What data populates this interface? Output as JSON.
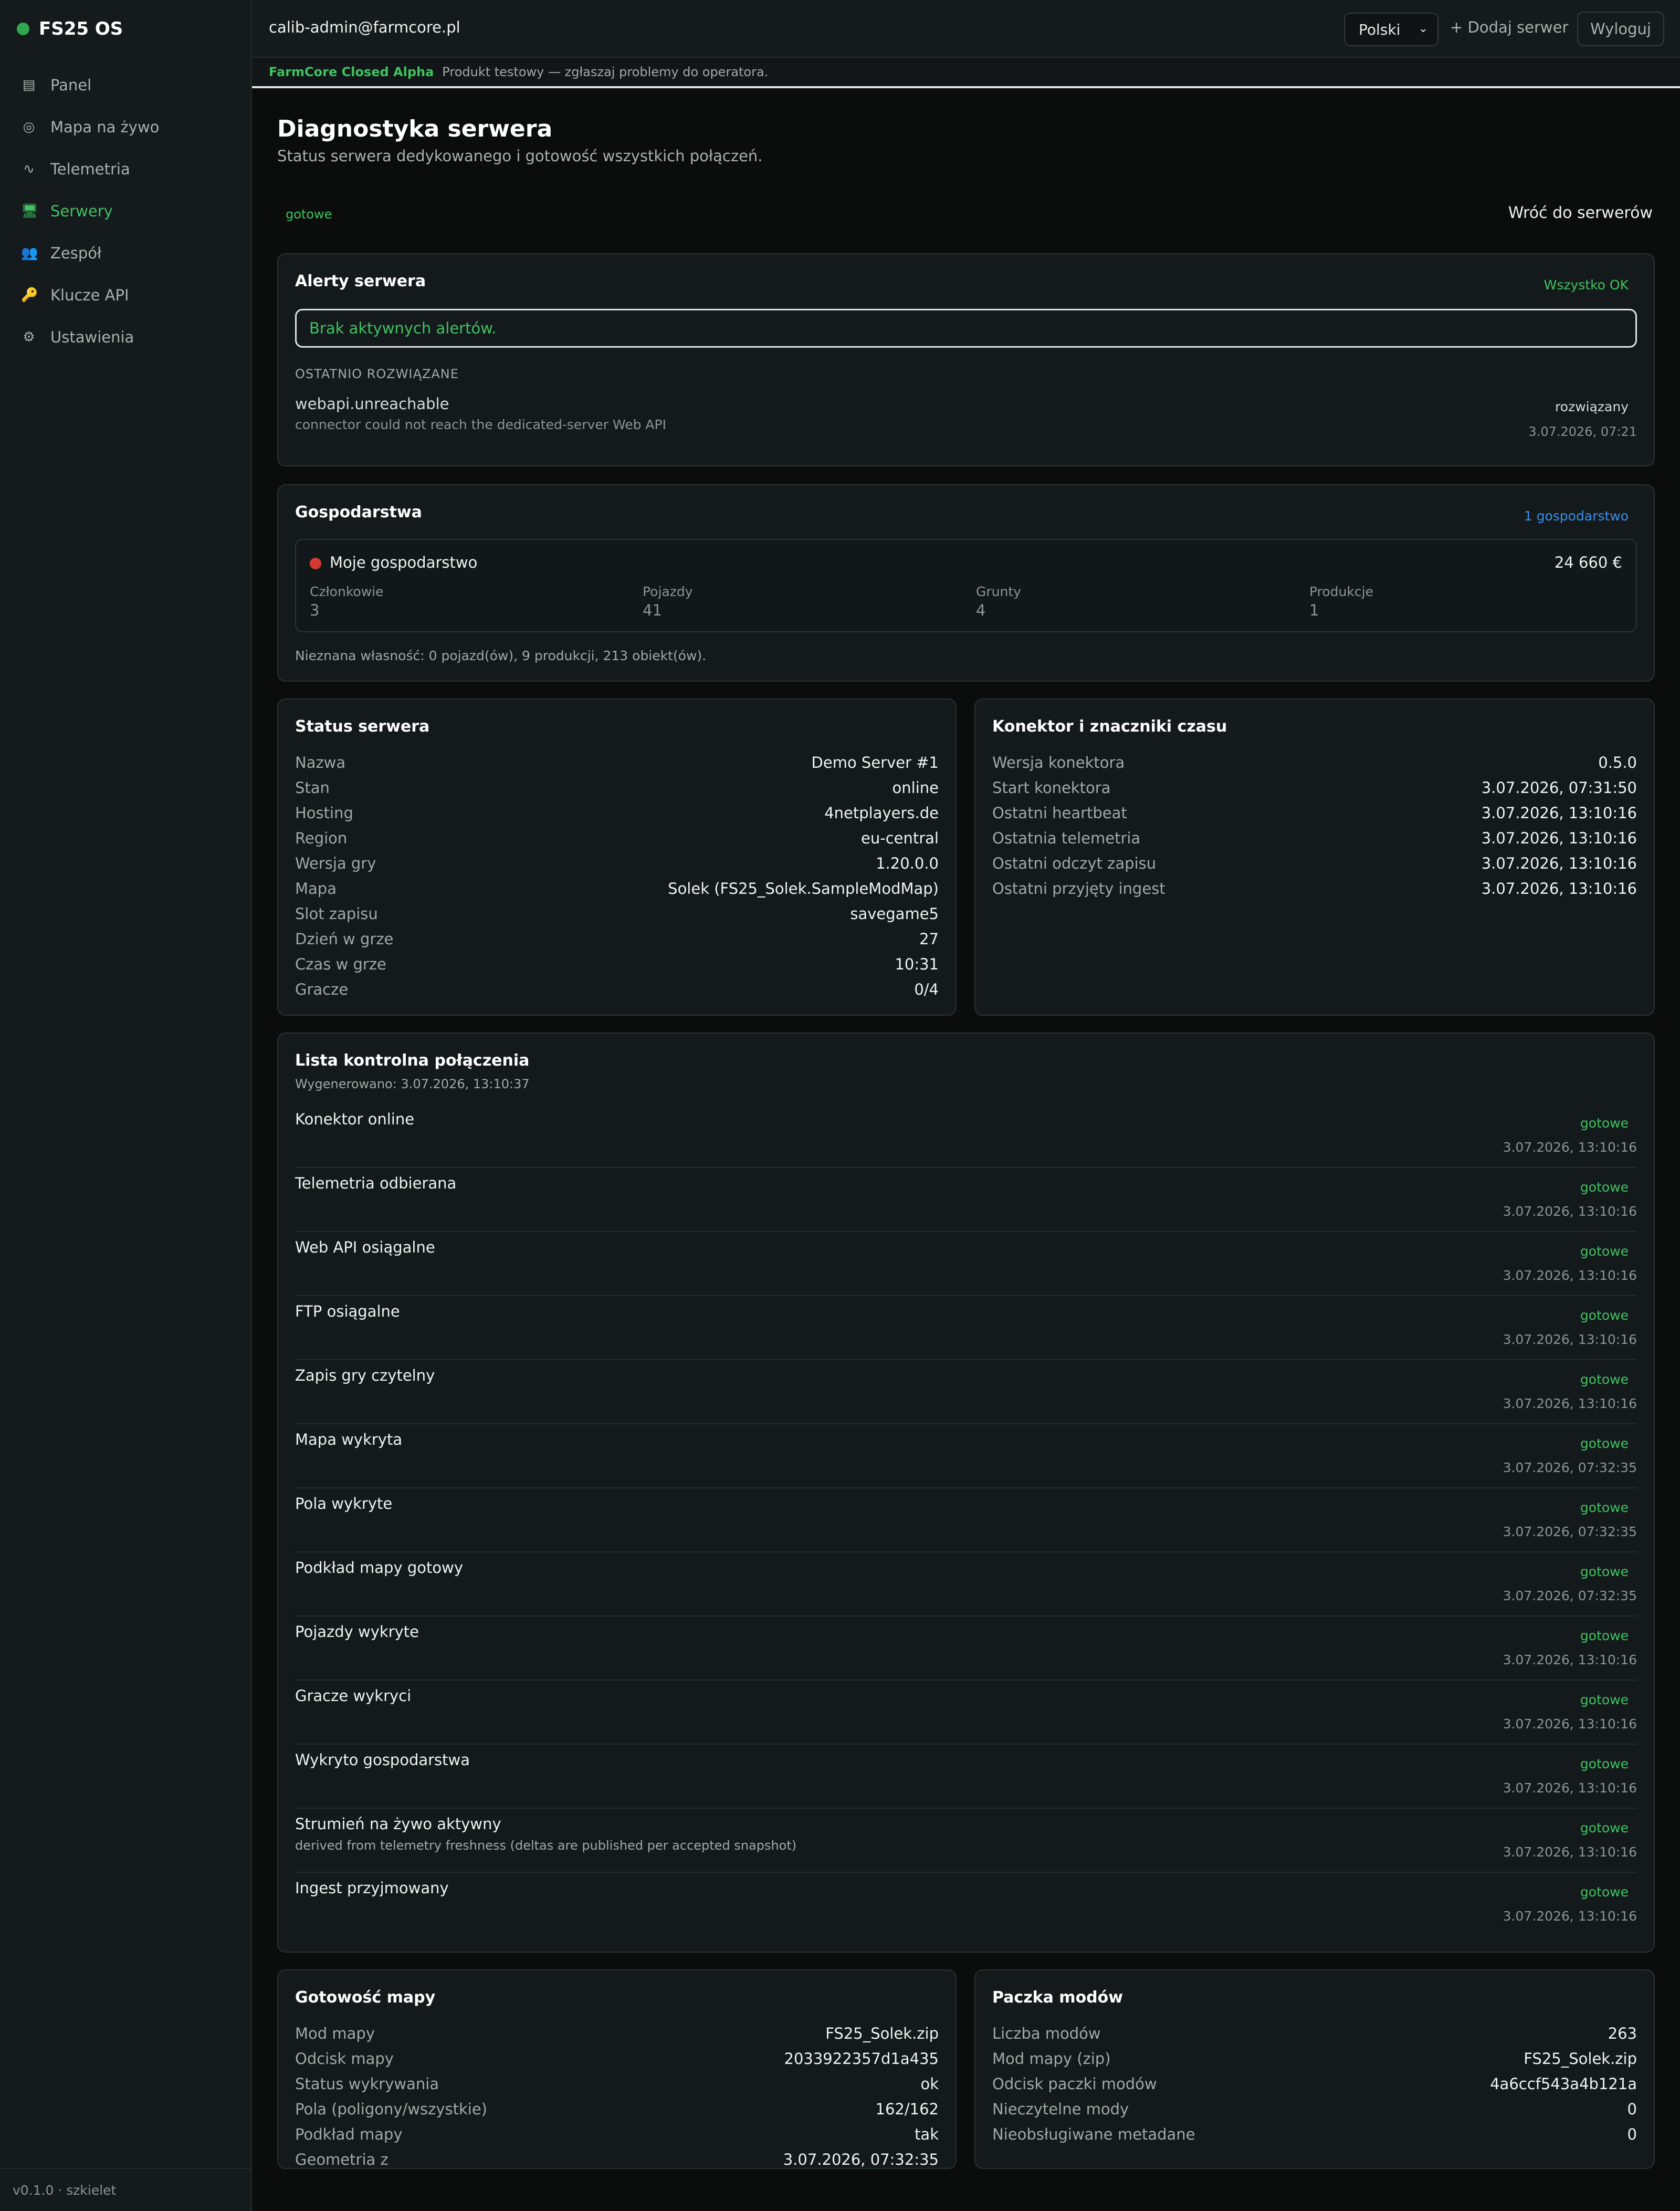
{
  "app": {
    "brand": "FS25 OS",
    "version": "v0.1.0 · szkielet"
  },
  "colors": {
    "accent": "#3fc25f",
    "link": "#3b8fe8",
    "danger": "#d33a32",
    "background": "#0a0d0b"
  },
  "sidebar": {
    "items": [
      {
        "label": "Panel",
        "icon": "dashboard-icon",
        "glyph": "▤"
      },
      {
        "label": "Mapa na żywo",
        "icon": "target-icon",
        "glyph": "◎"
      },
      {
        "label": "Telemetria",
        "icon": "wave-icon",
        "glyph": "∿"
      },
      {
        "label": "Serwery",
        "icon": "monitor-icon",
        "glyph": "🖥"
      },
      {
        "label": "Zespół",
        "icon": "people-icon",
        "glyph": "👥"
      },
      {
        "label": "Klucze API",
        "icon": "key-icon",
        "glyph": "🔑"
      },
      {
        "label": "Ustawienia",
        "icon": "gear-icon",
        "glyph": "⚙"
      }
    ],
    "active": "Serwery"
  },
  "topbar": {
    "user_email": "calib-admin@farmcore.pl",
    "language": "Polski",
    "add_server": "+ Dodaj serwer",
    "logout": "Wyloguj"
  },
  "alpha_banner": {
    "tag": "FarmCore Closed Alpha",
    "text": "Produkt testowy — zgłaszaj problemy do operatora."
  },
  "page": {
    "title": "Diagnostyka serwera",
    "subtitle": "Status serwera dedykowanego i gotowość wszystkich połączeń.",
    "status": "gotowe",
    "back": "Wróć do serwerów"
  },
  "alerts": {
    "title": "Alerty serwera",
    "badge": "Wszystko OK",
    "empty": "Brak aktywnych alertów.",
    "resolved_label": "OSTATNIO ROZWIĄZANE",
    "resolved": {
      "name": "webapi.unreachable",
      "description": "connector could not reach the dedicated-server Web API",
      "status": "rozwiązany",
      "time": "3.07.2026, 07:21"
    }
  },
  "farms": {
    "title": "Gospodarstwa",
    "badge": "1 gospodarstwo",
    "farm": {
      "name": "Moje gospodarstwo",
      "money": "24 660 €",
      "stats": [
        {
          "label": "Członkowie",
          "value": "3"
        },
        {
          "label": "Pojazdy",
          "value": "41"
        },
        {
          "label": "Grunty",
          "value": "4"
        },
        {
          "label": "Produkcje",
          "value": "1"
        }
      ]
    },
    "note": "Nieznana własność: 0 pojazd(ów), 9 produkcji, 213 obiekt(ów)."
  },
  "server_status": {
    "title": "Status serwera",
    "rows": [
      {
        "key": "Nazwa",
        "value": "Demo Server #1"
      },
      {
        "key": "Stan",
        "value": "online"
      },
      {
        "key": "Hosting",
        "value": "4netplayers.de"
      },
      {
        "key": "Region",
        "value": "eu-central"
      },
      {
        "key": "Wersja gry",
        "value": "1.20.0.0"
      },
      {
        "key": "Mapa",
        "value": "Solek (FS25_Solek.SampleModMap)"
      },
      {
        "key": "Slot zapisu",
        "value": "savegame5"
      },
      {
        "key": "Dzień w grze",
        "value": "27"
      },
      {
        "key": "Czas w grze",
        "value": "10:31"
      },
      {
        "key": "Gracze",
        "value": "0/4"
      }
    ]
  },
  "connector": {
    "title": "Konektor i znaczniki czasu",
    "rows": [
      {
        "key": "Wersja konektora",
        "value": "0.5.0"
      },
      {
        "key": "Start konektora",
        "value": "3.07.2026, 07:31:50"
      },
      {
        "key": "Ostatni heartbeat",
        "value": "3.07.2026, 13:10:16"
      },
      {
        "key": "Ostatnia telemetria",
        "value": "3.07.2026, 13:10:16"
      },
      {
        "key": "Ostatni odczyt zapisu",
        "value": "3.07.2026, 13:10:16"
      },
      {
        "key": "Ostatni przyjęty ingest",
        "value": "3.07.2026, 13:10:16"
      }
    ]
  },
  "checklist": {
    "title": "Lista kontrolna połączenia",
    "generated": "Wygenerowano: 3.07.2026, 13:10:37",
    "items": [
      {
        "name": "Konektor online",
        "note": "",
        "status": "gotowe",
        "time": "3.07.2026, 13:10:16"
      },
      {
        "name": "Telemetria odbierana",
        "note": "",
        "status": "gotowe",
        "time": "3.07.2026, 13:10:16"
      },
      {
        "name": "Web API osiągalne",
        "note": "",
        "status": "gotowe",
        "time": "3.07.2026, 13:10:16"
      },
      {
        "name": "FTP osiągalne",
        "note": "",
        "status": "gotowe",
        "time": "3.07.2026, 13:10:16"
      },
      {
        "name": "Zapis gry czytelny",
        "note": "",
        "status": "gotowe",
        "time": "3.07.2026, 13:10:16"
      },
      {
        "name": "Mapa wykryta",
        "note": "",
        "status": "gotowe",
        "time": "3.07.2026, 07:32:35"
      },
      {
        "name": "Pola wykryte",
        "note": "",
        "status": "gotowe",
        "time": "3.07.2026, 07:32:35"
      },
      {
        "name": "Podkład mapy gotowy",
        "note": "",
        "status": "gotowe",
        "time": "3.07.2026, 07:32:35"
      },
      {
        "name": "Pojazdy wykryte",
        "note": "",
        "status": "gotowe",
        "time": "3.07.2026, 13:10:16"
      },
      {
        "name": "Gracze wykryci",
        "note": "",
        "status": "gotowe",
        "time": "3.07.2026, 13:10:16"
      },
      {
        "name": "Wykryto gospodarstwa",
        "note": "",
        "status": "gotowe",
        "time": "3.07.2026, 13:10:16"
      },
      {
        "name": "Strumień na żywo aktywny",
        "note": "derived from telemetry freshness (deltas are published per accepted snapshot)",
        "status": "gotowe",
        "time": "3.07.2026, 13:10:16"
      },
      {
        "name": "Ingest przyjmowany",
        "note": "",
        "status": "gotowe",
        "time": "3.07.2026, 13:10:16"
      }
    ]
  },
  "map_readiness": {
    "title": "Gotowość mapy",
    "rows": [
      {
        "key": "Mod mapy",
        "value": "FS25_Solek.zip"
      },
      {
        "key": "Odcisk mapy",
        "value": "2033922357d1a435"
      },
      {
        "key": "Status wykrywania",
        "value": "ok"
      },
      {
        "key": "Pola (poligony/wszystkie)",
        "value": "162/162"
      },
      {
        "key": "Podkład mapy",
        "value": "tak"
      },
      {
        "key": "Geometria z",
        "value": "3.07.2026, 07:32:35"
      }
    ]
  },
  "mod_pack": {
    "title": "Paczka modów",
    "rows": [
      {
        "key": "Liczba modów",
        "value": "263"
      },
      {
        "key": "Mod mapy (zip)",
        "value": "FS25_Solek.zip"
      },
      {
        "key": "Odcisk paczki modów",
        "value": "4a6ccf543a4b121a"
      },
      {
        "key": "Nieczytelne mody",
        "value": "0"
      },
      {
        "key": "Nieobsługiwane metadane",
        "value": "0"
      }
    ]
  }
}
